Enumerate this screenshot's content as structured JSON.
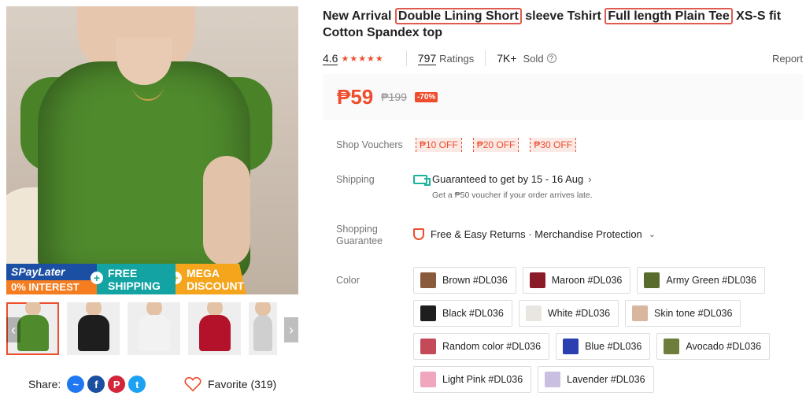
{
  "title": {
    "part1": "New Arrival",
    "hl1": "Double Lining Short",
    "part2": "sleeve Tshirt",
    "hl2": "Full length Plain Tee",
    "part3": "XS-S fit Cotton Spandex top"
  },
  "stats": {
    "rating": "4.6",
    "stars": "★★★★★",
    "ratings_count": "797",
    "ratings_label": "Ratings",
    "sold_count": "7K+",
    "sold_label": "Sold",
    "report": "Report"
  },
  "price": {
    "current": "₱59",
    "original": "₱199",
    "discount": "-70%"
  },
  "vouchers": {
    "label": "Shop Vouchers",
    "items": [
      "₱10 OFF",
      "₱20 OFF",
      "₱30 OFF"
    ]
  },
  "shipping": {
    "label": "Shipping",
    "line": "Guaranteed to get by 15 - 16 Aug",
    "sub": "Get a ₱50 voucher if your order arrives late."
  },
  "guarantee": {
    "label_line1": "Shopping",
    "label_line2": "Guarantee",
    "line": "Free & Easy Returns · Merchandise Protection"
  },
  "colors": {
    "label": "Color",
    "options": [
      {
        "label": "Brown #DL036",
        "swatch": "#8a5a3c"
      },
      {
        "label": "Maroon #DL036",
        "swatch": "#8a1c2a"
      },
      {
        "label": "Army Green #DL036",
        "swatch": "#5a6b2e"
      },
      {
        "label": "Black #DL036",
        "swatch": "#1e1e1e"
      },
      {
        "label": "White #DL036",
        "swatch": "#e9e6e1"
      },
      {
        "label": "Skin tone #DL036",
        "swatch": "#d8b79e"
      },
      {
        "label": "Random color #DL036",
        "swatch": "#c44a5a"
      },
      {
        "label": "Blue #DL036",
        "swatch": "#2a3fb0"
      },
      {
        "label": "Avocado #DL036",
        "swatch": "#6f7d3a"
      },
      {
        "label": "Light Pink #DL036",
        "swatch": "#f0a7bd"
      },
      {
        "label": "Lavender #DL036",
        "swatch": "#c9bfe0"
      }
    ]
  },
  "promo": {
    "paylater": "SPayLater",
    "interest": "0% INTEREST",
    "shipping1": "FREE",
    "shipping2": "SHIPPING",
    "mega1": "MEGA",
    "mega2": "DISCOUNT"
  },
  "share": {
    "label": "Share:",
    "favorite": "Favorite (319)"
  },
  "thumbs": [
    "#4f8a2d",
    "#1e1e1e",
    "#f2f2f2",
    "#b3122a",
    "#cfcfcf"
  ]
}
